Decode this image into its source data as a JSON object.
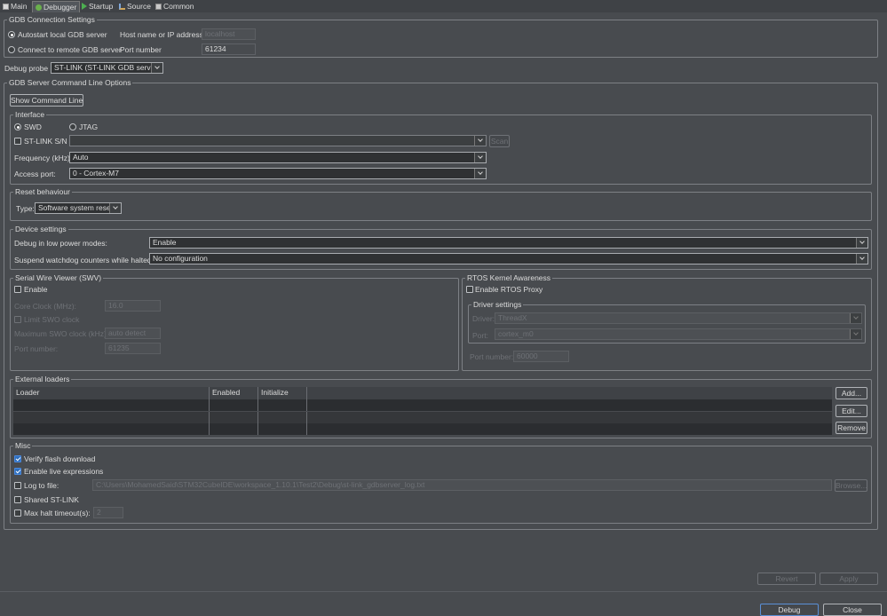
{
  "tabs": [
    {
      "label": "Main",
      "icon": "page-icon"
    },
    {
      "label": "Debugger",
      "icon": "bug-icon",
      "active": true
    },
    {
      "label": "Startup",
      "icon": "play-icon"
    },
    {
      "label": "Source",
      "icon": "source-icon"
    },
    {
      "label": "Common",
      "icon": "common-icon"
    }
  ],
  "gdb_connection": {
    "legend": "GDB Connection Settings",
    "autostart_label": "Autostart local GDB server",
    "remote_label": "Connect to remote GDB server",
    "host_label": "Host name or IP address",
    "host_value": "localhost",
    "port_label": "Port number",
    "port_value": "61234"
  },
  "debug_probe": {
    "label": "Debug probe",
    "value": "ST-LINK (ST-LINK GDB server)"
  },
  "gdb_server_options": {
    "legend": "GDB Server Command Line Options",
    "show_command_line": "Show Command Line"
  },
  "interface": {
    "legend": "Interface",
    "swd_label": "SWD",
    "jtag_label": "JTAG",
    "stlink_sn_label": "ST-LINK S/N",
    "stlink_sn_value": "",
    "scan_label": "Scan",
    "frequency_label": "Frequency (kHz):",
    "frequency_value": "Auto",
    "access_port_label": "Access port:",
    "access_port_value": "0 - Cortex-M7"
  },
  "reset": {
    "legend": "Reset behaviour",
    "type_label": "Type:",
    "type_value": "Software system reset"
  },
  "device": {
    "legend": "Device settings",
    "low_power_label": "Debug in low power modes:",
    "low_power_value": "Enable",
    "watchdog_label": "Suspend watchdog counters while halted:",
    "watchdog_value": "No configuration"
  },
  "swv": {
    "legend": "Serial Wire Viewer (SWV)",
    "enable_label": "Enable",
    "core_clock_label": "Core Clock (MHz):",
    "core_clock_value": "16.0",
    "limit_swo_label": "Limit SWO clock",
    "max_swo_label": "Maximum SWO clock (kHz):",
    "max_swo_value": "auto detect",
    "port_label": "Port number:",
    "port_value": "61235"
  },
  "rtos": {
    "legend": "RTOS Kernel Awareness",
    "enable_proxy_label": "Enable RTOS Proxy",
    "driver_legend": "Driver settings",
    "driver_label": "Driver:",
    "driver_value": "ThreadX",
    "port_label": "Port:",
    "port_value": "cortex_m0",
    "port_number_label": "Port number:",
    "port_number_value": "60000"
  },
  "external_loaders": {
    "legend": "External loaders",
    "columns": [
      "Loader",
      "Enabled",
      "Initialize"
    ],
    "add": "Add...",
    "edit": "Edit...",
    "remove": "Remove"
  },
  "misc": {
    "legend": "Misc",
    "verify_flash": "Verify flash download",
    "live_expressions": "Enable live expressions",
    "log_to_file": "Log to file:",
    "log_path": "C:\\Users\\MohamedSaid\\STM32CubeIDE\\workspace_1.10.1\\Test2\\Debug\\st-link_gdbserver_log.txt",
    "browse": "Browse...",
    "shared_stlink": "Shared ST-LINK",
    "max_halt": "Max halt timeout(s):",
    "max_halt_value": "2"
  },
  "footer": {
    "revert": "Revert",
    "apply": "Apply",
    "debug": "Debug",
    "close": "Close"
  },
  "colors": {
    "background": "#484b4f",
    "accent": "#2f6fbd"
  }
}
